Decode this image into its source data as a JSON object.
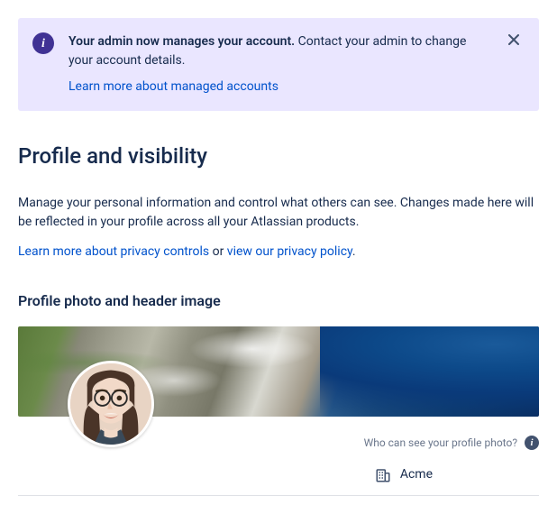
{
  "banner": {
    "bold_text": "Your admin now manages your account.",
    "text": " Contact your admin to change your account details.",
    "link_text": "Learn more about managed accounts"
  },
  "page": {
    "title": "Profile and visibility",
    "description": "Manage your personal information and control what others can see. Changes made here will be reflected in your profile across all your Atlassian products.",
    "privacy_link": "Learn more about privacy controls",
    "or_text": " or ",
    "policy_link": "view our privacy policy",
    "period": "."
  },
  "section": {
    "title": "Profile photo and header image",
    "visibility_label": "Who can see your profile photo?",
    "org_name": "Acme"
  }
}
